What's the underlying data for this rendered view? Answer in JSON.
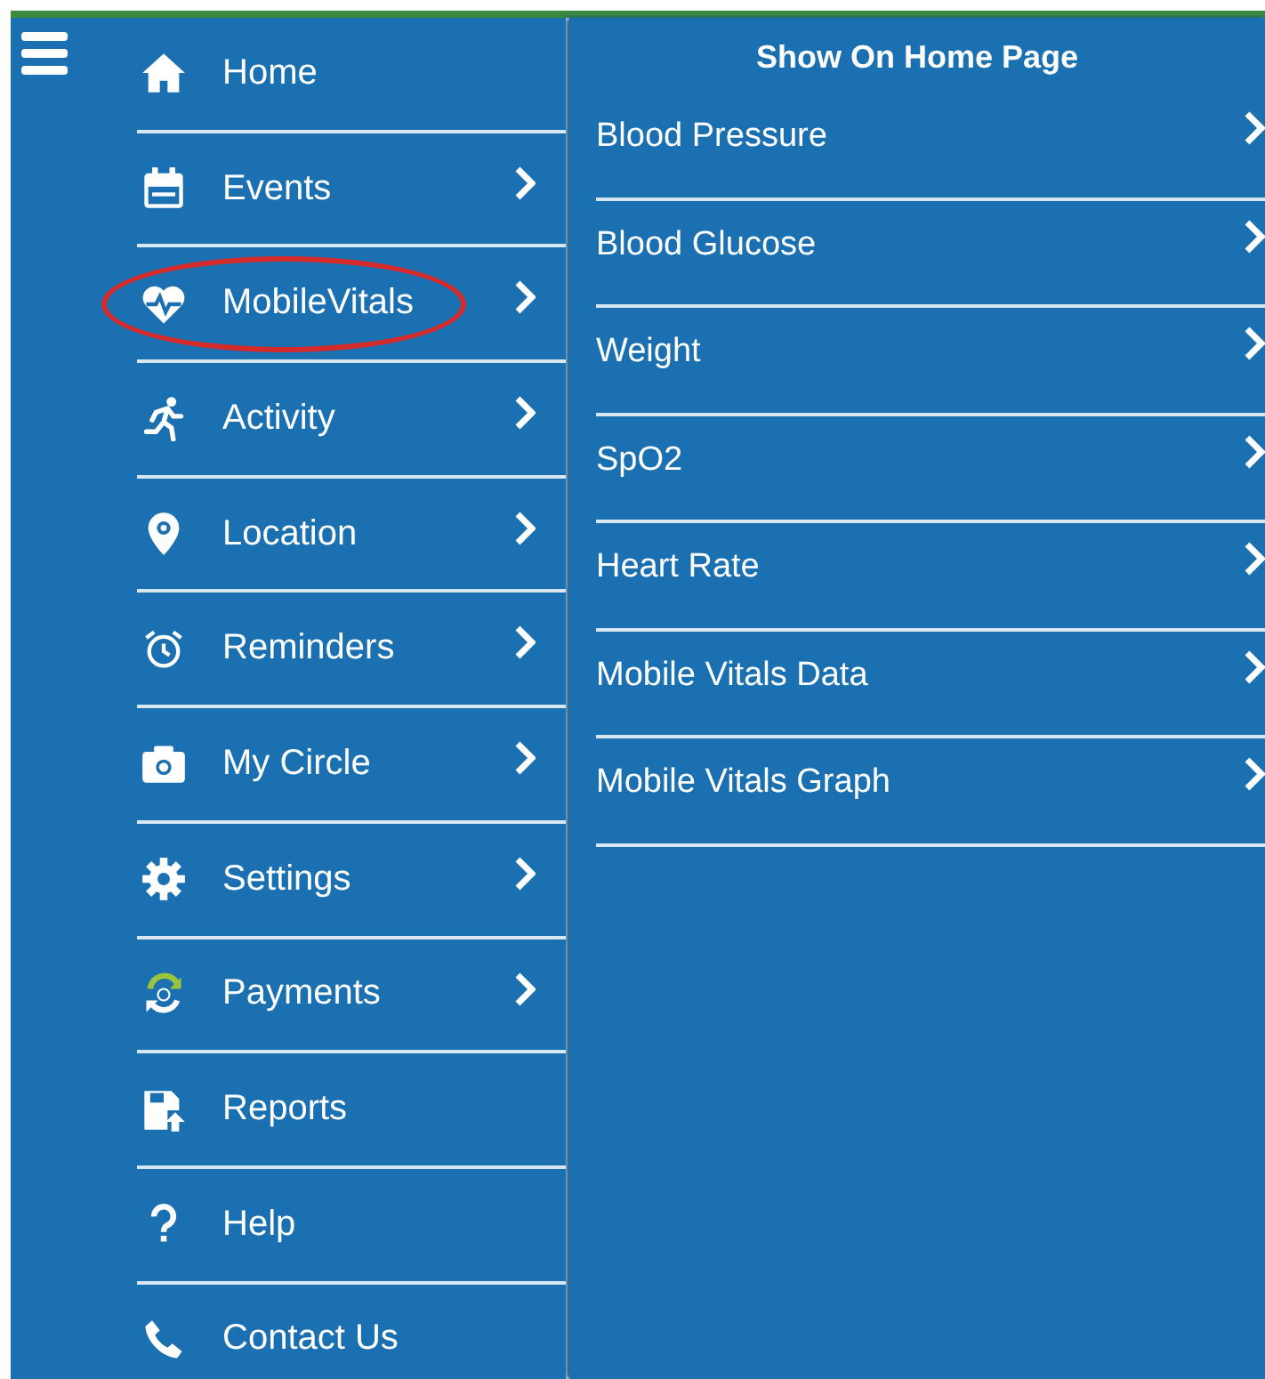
{
  "sidebar": {
    "items": [
      {
        "label": "Home",
        "has_submenu": false,
        "highlighted": false
      },
      {
        "label": "Events",
        "has_submenu": true,
        "highlighted": false
      },
      {
        "label": "MobileVitals",
        "has_submenu": true,
        "highlighted": true
      },
      {
        "label": "Activity",
        "has_submenu": true,
        "highlighted": false
      },
      {
        "label": "Location",
        "has_submenu": true,
        "highlighted": false
      },
      {
        "label": "Reminders",
        "has_submenu": true,
        "highlighted": false
      },
      {
        "label": "My Circle",
        "has_submenu": true,
        "highlighted": false
      },
      {
        "label": "Settings",
        "has_submenu": true,
        "highlighted": false
      },
      {
        "label": "Payments",
        "has_submenu": true,
        "highlighted": false
      },
      {
        "label": "Reports",
        "has_submenu": false,
        "highlighted": false
      },
      {
        "label": "Help",
        "has_submenu": false,
        "highlighted": false
      },
      {
        "label": "Contact Us",
        "has_submenu": false,
        "highlighted": false
      }
    ]
  },
  "submenu": {
    "title": "Show On Home Page",
    "items": [
      {
        "label": "Blood Pressure",
        "has_submenu": true
      },
      {
        "label": "Blood Glucose",
        "has_submenu": true
      },
      {
        "label": "Weight",
        "has_submenu": true
      },
      {
        "label": "SpO2",
        "has_submenu": true
      },
      {
        "label": "Heart Rate",
        "has_submenu": true
      },
      {
        "label": "Mobile Vitals Data",
        "has_submenu": true
      },
      {
        "label": "Mobile Vitals Graph",
        "has_submenu": true
      }
    ]
  }
}
